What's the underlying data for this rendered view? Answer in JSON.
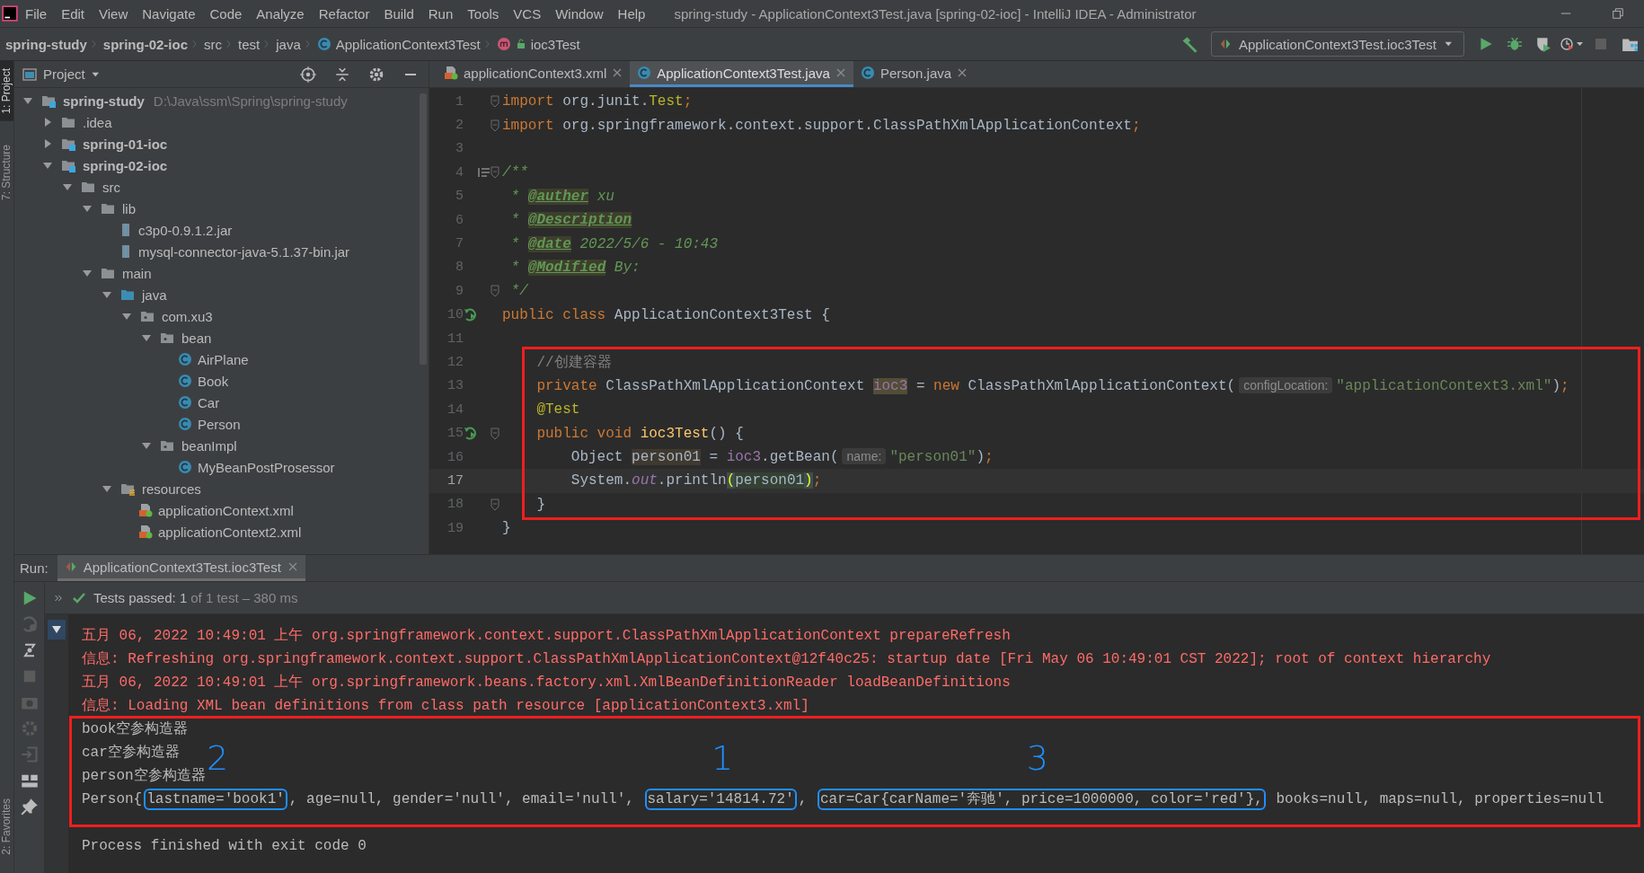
{
  "window": {
    "title": "spring-study - ApplicationContext3Test.java [spring-02-ioc] - IntelliJ IDEA - Administrator"
  },
  "menu": [
    "File",
    "Edit",
    "View",
    "Navigate",
    "Code",
    "Analyze",
    "Refactor",
    "Build",
    "Run",
    "Tools",
    "VCS",
    "Window",
    "Help"
  ],
  "breadcrumbs": [
    {
      "label": "spring-study",
      "kind": "module"
    },
    {
      "label": "spring-02-ioc",
      "kind": "module"
    },
    {
      "label": "src",
      "kind": "folder"
    },
    {
      "label": "test",
      "kind": "folder"
    },
    {
      "label": "java",
      "kind": "folder"
    },
    {
      "label": "ApplicationContext3Test",
      "kind": "class"
    },
    {
      "label": "ioc3Test",
      "kind": "method"
    }
  ],
  "run_config": {
    "label": "ApplicationContext3Test.ioc3Test"
  },
  "side_tabs": [
    {
      "label": "1: Project",
      "selected": true
    },
    {
      "label": "7: Structure",
      "selected": false
    },
    {
      "label": "2: Favorites",
      "selected": false
    }
  ],
  "project": {
    "title": "Project",
    "tree": [
      {
        "label": "spring-study",
        "kind": "module",
        "detail": "D:\\Java\\ssm\\Spring\\spring-study",
        "expanded": true,
        "children": [
          {
            "label": ".idea",
            "kind": "folder",
            "expanded": false
          },
          {
            "label": "spring-01-ioc",
            "kind": "module",
            "expanded": false
          },
          {
            "label": "spring-02-ioc",
            "kind": "module",
            "expanded": true,
            "children": [
              {
                "label": "src",
                "kind": "folder",
                "expanded": true,
                "children": [
                  {
                    "label": "lib",
                    "kind": "folder",
                    "expanded": true,
                    "children": [
                      {
                        "label": "c3p0-0.9.1.2.jar",
                        "kind": "jar"
                      },
                      {
                        "label": "mysql-connector-java-5.1.37-bin.jar",
                        "kind": "jar"
                      }
                    ]
                  },
                  {
                    "label": "main",
                    "kind": "folder",
                    "expanded": true,
                    "children": [
                      {
                        "label": "java",
                        "kind": "source",
                        "expanded": true,
                        "children": [
                          {
                            "label": "com.xu3",
                            "kind": "package",
                            "expanded": true,
                            "children": [
                              {
                                "label": "bean",
                                "kind": "package",
                                "expanded": true,
                                "children": [
                                  {
                                    "label": "AirPlane",
                                    "kind": "class"
                                  },
                                  {
                                    "label": "Book",
                                    "kind": "class"
                                  },
                                  {
                                    "label": "Car",
                                    "kind": "class"
                                  },
                                  {
                                    "label": "Person",
                                    "kind": "class"
                                  }
                                ]
                              },
                              {
                                "label": "beanImpl",
                                "kind": "package",
                                "expanded": true,
                                "children": [
                                  {
                                    "label": "MyBeanPostProsessor",
                                    "kind": "class"
                                  }
                                ]
                              }
                            ]
                          }
                        ]
                      },
                      {
                        "label": "resources",
                        "kind": "resources",
                        "expanded": true,
                        "children": [
                          {
                            "label": "applicationContext.xml",
                            "kind": "xml"
                          },
                          {
                            "label": "applicationContext2.xml",
                            "kind": "xml"
                          }
                        ]
                      }
                    ]
                  }
                ]
              }
            ]
          }
        ]
      }
    ]
  },
  "editor": {
    "tabs": [
      {
        "label": "applicationContext3.xml",
        "kind": "xml",
        "selected": false
      },
      {
        "label": "ApplicationContext3Test.java",
        "kind": "class",
        "selected": true
      },
      {
        "label": "Person.java",
        "kind": "class",
        "selected": false
      }
    ],
    "lines": [
      {
        "no": "1",
        "current": false,
        "framed": false,
        "run": false,
        "doc": false,
        "fold": true,
        "tokens": [
          {
            "kind": "kw",
            "text": "import "
          },
          {
            "kind": "plain",
            "text": "org.junit."
          },
          {
            "kind": "ann",
            "text": "Test"
          },
          {
            "kind": "kw",
            "text": ";"
          }
        ]
      },
      {
        "no": "2",
        "current": false,
        "framed": false,
        "run": false,
        "doc": false,
        "fold": true,
        "tokens": [
          {
            "kind": "kw",
            "text": "import "
          },
          {
            "kind": "plain",
            "text": "org.springframework.context.support.ClassPathXmlApplicationContext"
          },
          {
            "kind": "kw",
            "text": ";"
          }
        ]
      },
      {
        "no": "3",
        "current": false,
        "framed": false,
        "run": false,
        "doc": false,
        "fold": false
      },
      {
        "no": "4",
        "current": false,
        "framed": false,
        "run": false,
        "doc": true,
        "fold": true,
        "tokens": [
          {
            "kind": "doc",
            "text": "/**"
          }
        ]
      },
      {
        "no": "5",
        "current": false,
        "framed": false,
        "run": false,
        "doc": false,
        "fold": false,
        "tokens": [
          {
            "kind": "doc",
            "text": " * "
          },
          {
            "kind": "tag",
            "text": "@auther"
          },
          {
            "kind": "doc",
            "text": " xu"
          }
        ]
      },
      {
        "no": "6",
        "current": false,
        "framed": false,
        "run": false,
        "doc": false,
        "fold": false,
        "tokens": [
          {
            "kind": "doc",
            "text": " * "
          },
          {
            "kind": "tag",
            "text": "@Description"
          }
        ]
      },
      {
        "no": "7",
        "current": false,
        "framed": false,
        "run": false,
        "doc": false,
        "fold": false,
        "tokens": [
          {
            "kind": "doc",
            "text": " * "
          },
          {
            "kind": "tag",
            "text": "@date"
          },
          {
            "kind": "doc",
            "text": " 2022/5/6 - 10:43"
          }
        ]
      },
      {
        "no": "8",
        "current": false,
        "framed": false,
        "run": false,
        "doc": false,
        "fold": false,
        "tokens": [
          {
            "kind": "doc",
            "text": " * "
          },
          {
            "kind": "tag",
            "text": "@Modified"
          },
          {
            "kind": "doc",
            "text": " By:"
          }
        ]
      },
      {
        "no": "9",
        "current": false,
        "framed": false,
        "run": false,
        "doc": false,
        "fold": true,
        "tokens": [
          {
            "kind": "doc",
            "text": " */"
          }
        ]
      },
      {
        "no": "10",
        "current": false,
        "framed": false,
        "run": true,
        "doc": false,
        "fold": false,
        "tokens": [
          {
            "kind": "kw",
            "text": "public class "
          },
          {
            "kind": "plain",
            "text": "ApplicationContext3Test {"
          }
        ]
      },
      {
        "no": "11",
        "current": false,
        "framed": false,
        "run": false,
        "doc": false,
        "fold": false
      },
      {
        "no": "12",
        "current": false,
        "framed": true,
        "run": false,
        "doc": false,
        "fold": false,
        "tokens": [
          {
            "kind": "comment",
            "text": "    //创建容器"
          }
        ]
      },
      {
        "no": "13",
        "current": false,
        "framed": true,
        "run": false,
        "doc": false,
        "fold": false,
        "tokens": [
          {
            "kind": "kw",
            "text": "    private "
          },
          {
            "kind": "plain",
            "text": "ClassPathXmlApplicationContext "
          },
          {
            "kind": "fieldmark",
            "text": "ioc3"
          },
          {
            "kind": "plain",
            "text": " = "
          },
          {
            "kind": "kw",
            "text": "new "
          },
          {
            "kind": "plain",
            "text": "ClassPathXmlApplicationContext("
          },
          {
            "kind": "hint",
            "text": "configLocation:"
          },
          {
            "kind": "string",
            "text": "\"applicationContext3.xml\""
          },
          {
            "kind": "plain",
            "text": ")"
          },
          {
            "kind": "kw",
            "text": ";"
          }
        ]
      },
      {
        "no": "14",
        "current": false,
        "framed": true,
        "run": false,
        "doc": false,
        "fold": false,
        "tokens": [
          {
            "kind": "ann",
            "text": "    @Test"
          }
        ]
      },
      {
        "no": "15",
        "current": false,
        "framed": true,
        "run": true,
        "doc": false,
        "fold": true,
        "tokens": [
          {
            "kind": "kw",
            "text": "    public void "
          },
          {
            "kind": "method",
            "text": "ioc3Test"
          },
          {
            "kind": "plain",
            "text": "() {"
          }
        ]
      },
      {
        "no": "16",
        "current": false,
        "framed": true,
        "run": false,
        "doc": false,
        "fold": false,
        "tokens": [
          {
            "kind": "plain",
            "text": "        Object "
          },
          {
            "kind": "varmark",
            "text": "person01"
          },
          {
            "kind": "plain",
            "text": " = "
          },
          {
            "kind": "field",
            "text": "ioc3"
          },
          {
            "kind": "plain",
            "text": ".getBean("
          },
          {
            "kind": "hint",
            "text": "name:"
          },
          {
            "kind": "string",
            "text": "\"person01\""
          },
          {
            "kind": "plain",
            "text": ")"
          },
          {
            "kind": "kw",
            "text": ";"
          }
        ]
      },
      {
        "no": "17",
        "current": true,
        "framed": true,
        "run": false,
        "doc": false,
        "fold": false,
        "tokens": [
          {
            "kind": "plain",
            "text": "        System."
          },
          {
            "kind": "static",
            "text": "out"
          },
          {
            "kind": "plain",
            "text": ".println"
          },
          {
            "kind": "brace",
            "text": "("
          },
          {
            "kind": "varmatch",
            "text": "person01"
          },
          {
            "kind": "brace",
            "text": ")"
          },
          {
            "kind": "kw",
            "text": ";"
          }
        ]
      },
      {
        "no": "18",
        "current": false,
        "framed": true,
        "run": false,
        "doc": false,
        "fold": true,
        "tokens": [
          {
            "kind": "plain",
            "text": "    }"
          }
        ]
      },
      {
        "no": "19",
        "current": false,
        "framed": false,
        "run": false,
        "doc": false,
        "fold": false,
        "tokens": [
          {
            "kind": "plain",
            "text": "}"
          }
        ]
      }
    ]
  },
  "run": {
    "label": "Run:",
    "tab": "ApplicationContext3Test.ioc3Test",
    "status": "Tests passed: 1",
    "status_detail": "of 1 test – 380 ms",
    "console": [
      {
        "kind": "log",
        "framed": false,
        "text": "五月 06, 2022 10:49:01 上午 org.springframework.context.support.ClassPathXmlApplicationContext prepareRefresh"
      },
      {
        "kind": "log",
        "framed": false,
        "text": "信息: Refreshing org.springframework.context.support.ClassPathXmlApplicationContext@12f40c25: startup date [Fri May 06 10:49:01 CST 2022]; root of context hierarchy"
      },
      {
        "kind": "log",
        "framed": false,
        "text": "五月 06, 2022 10:49:01 上午 org.springframework.beans.factory.xml.XmlBeanDefinitionReader loadBeanDefinitions"
      },
      {
        "kind": "log",
        "framed": false,
        "text": "信息: Loading XML bean definitions from class path resource [applicationContext3.xml]"
      },
      {
        "kind": "out",
        "framed": true,
        "text": "book空参构造器"
      },
      {
        "kind": "out",
        "framed": true,
        "text": "car空参构造器"
      },
      {
        "kind": "out",
        "framed": true,
        "text": "person空参构造器"
      },
      {
        "kind": "out",
        "framed": true,
        "segments": [
          {
            "text": "Person{",
            "boxed": false
          },
          {
            "text": "lastname='book1'",
            "boxed": true,
            "note": "2"
          },
          {
            "text": ", age=null, gender='null', email='null', ",
            "boxed": false
          },
          {
            "text": "salary='14814.72'",
            "boxed": true,
            "note": "1"
          },
          {
            "text": ", ",
            "boxed": false
          },
          {
            "text": "car=Car{carName='奔驰', price=1000000, color='red'},",
            "boxed": true,
            "note": "3"
          },
          {
            "text": " books=null, maps=null, properties=null",
            "boxed": false
          }
        ]
      },
      {
        "kind": "exit",
        "framed": false,
        "text": "Process finished with exit code 0"
      }
    ]
  }
}
